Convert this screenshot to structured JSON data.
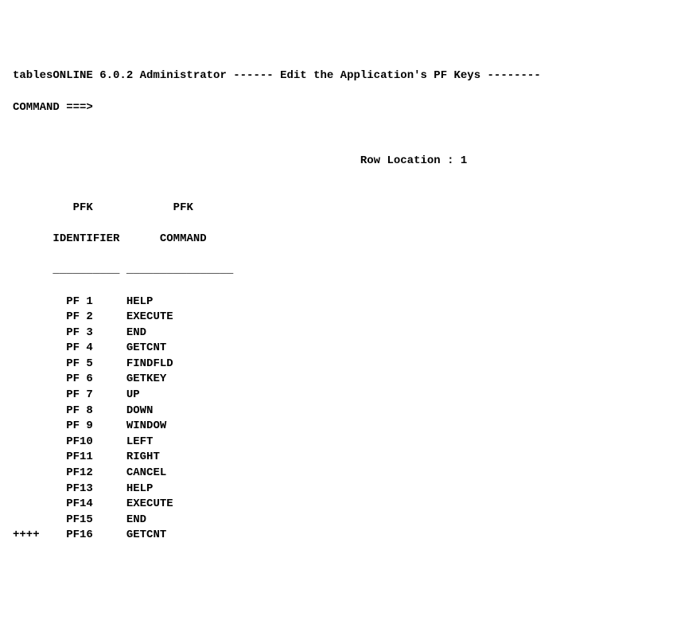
{
  "header": {
    "title_left": "tablesONLINE 6.0.2 Administrator",
    "title_right": "Edit the Application's PF Keys",
    "separator_mid": " ------ ",
    "separator_right": " --------"
  },
  "command": {
    "label": "COMMAND ===>",
    "value": ""
  },
  "row_location": {
    "label": "Row Location :",
    "value": "1"
  },
  "table": {
    "header1_line1": "PFK",
    "header1_line2": "IDENTIFIER",
    "header2_line1": "PFK",
    "header2_line2": "COMMAND",
    "underline1": "__________",
    "underline2": "________________",
    "marker": "++++",
    "rows": [
      {
        "id": "PF 1",
        "cmd": "HELP"
      },
      {
        "id": "PF 2",
        "cmd": "EXECUTE"
      },
      {
        "id": "PF 3",
        "cmd": "END"
      },
      {
        "id": "PF 4",
        "cmd": "GETCNT"
      },
      {
        "id": "PF 5",
        "cmd": "FINDFLD"
      },
      {
        "id": "PF 6",
        "cmd": "GETKEY"
      },
      {
        "id": "PF 7",
        "cmd": "UP"
      },
      {
        "id": "PF 8",
        "cmd": "DOWN"
      },
      {
        "id": "PF 9",
        "cmd": "WINDOW"
      },
      {
        "id": "PF10",
        "cmd": "LEFT"
      },
      {
        "id": "PF11",
        "cmd": "RIGHT"
      },
      {
        "id": "PF12",
        "cmd": "CANCEL"
      },
      {
        "id": "PF13",
        "cmd": "HELP"
      },
      {
        "id": "PF14",
        "cmd": "EXECUTE"
      },
      {
        "id": "PF15",
        "cmd": "END"
      },
      {
        "id": "PF16",
        "cmd": "GETCNT"
      }
    ]
  }
}
